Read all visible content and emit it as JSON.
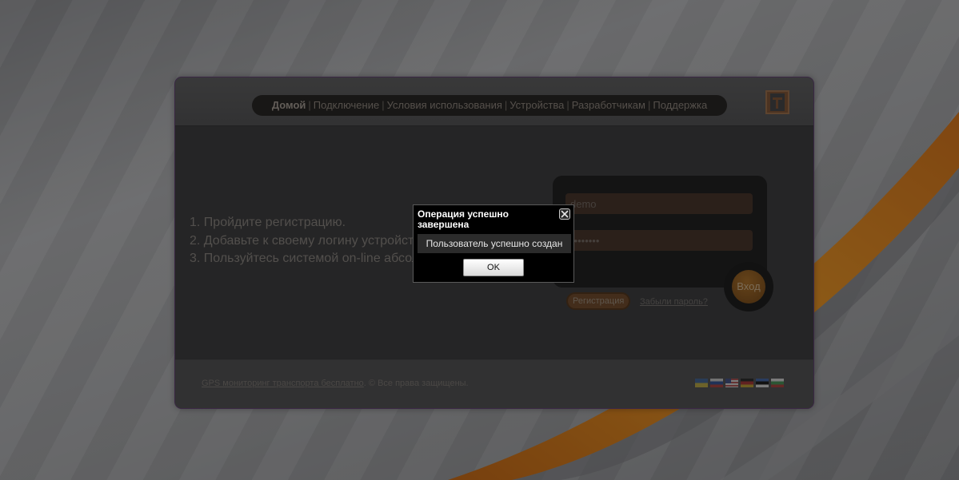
{
  "nav": {
    "items": [
      {
        "label": "Домой",
        "active": true
      },
      {
        "label": "Подключение"
      },
      {
        "label": "Условия использования"
      },
      {
        "label": "Устройства"
      },
      {
        "label": "Разработчикам"
      },
      {
        "label": "Поддержка"
      }
    ],
    "separator": "|"
  },
  "header": {
    "social_icon": "twitter-icon"
  },
  "steps": [
    "1. Пройдите регистрацию.",
    "2. Добавьте к своему логину устройст",
    "3. Пользуйтесь системой on-line абсолютно б"
  ],
  "login": {
    "username_value": "demo",
    "password_value": "••••••••",
    "login_button": "Вход",
    "register_button": "Регистрация",
    "forgot_link": "Забыли пароль?"
  },
  "footer": {
    "link_text": "GPS мониторинг транспорта бесплатно",
    "copyright": ". © Все права защищены.",
    "flags": [
      "ua-flag",
      "ru-flag",
      "us-flag",
      "de-flag",
      "ee-flag",
      "bg-flag"
    ]
  },
  "dialog": {
    "title": "Операция успешно завершена",
    "message": "Пользователь успешно создан",
    "ok_label": "OK"
  },
  "colors": {
    "accent_orange": "#e07a10",
    "panel_border": "#5b3a6e"
  }
}
